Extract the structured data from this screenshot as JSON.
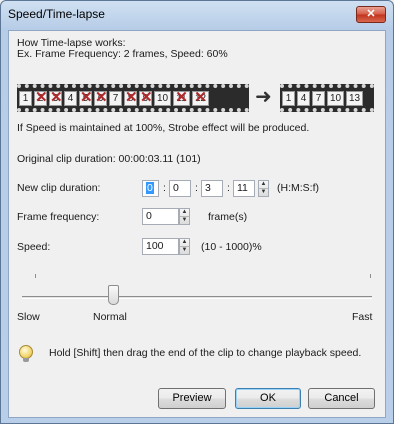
{
  "window": {
    "title": "Speed/Time-lapse",
    "close_glyph": "✕"
  },
  "info": {
    "line1": "How Time-lapse works:",
    "line2": "Ex. Frame Frequency: 2 frames, Speed: 60%"
  },
  "film_source": {
    "frames": [
      {
        "label": "1",
        "crossed": false
      },
      {
        "label": "2",
        "crossed": true
      },
      {
        "label": "3",
        "crossed": true
      },
      {
        "label": "4",
        "crossed": false
      },
      {
        "label": "5",
        "crossed": true
      },
      {
        "label": "6",
        "crossed": true
      },
      {
        "label": "7",
        "crossed": false
      },
      {
        "label": "8",
        "crossed": true
      },
      {
        "label": "9",
        "crossed": true
      },
      {
        "label": "10",
        "crossed": false
      },
      {
        "label": "11",
        "crossed": true
      },
      {
        "label": "12",
        "crossed": true
      }
    ]
  },
  "film_result": {
    "frames": [
      "1",
      "4",
      "7",
      "10",
      "13"
    ]
  },
  "arrow_glyph": "➜",
  "strobe_note": "If Speed is maintained at 100%, Strobe effect will be produced.",
  "original_duration": "Original clip duration: 00:00:03.11 (101)",
  "new_duration": {
    "label": "New clip duration:",
    "h": "0",
    "m": "0",
    "s": "3",
    "f": "11",
    "sep": ":",
    "format": "(H:M:S:f)"
  },
  "frame_frequency": {
    "label": "Frame frequency:",
    "value": "0",
    "unit": "frame(s)"
  },
  "speed": {
    "label": "Speed:",
    "value": "100",
    "range": "(10 - 1000)%"
  },
  "slider": {
    "slow": "Slow",
    "normal": "Normal",
    "fast": "Fast",
    "position_fraction": 0.25
  },
  "tip": "Hold [Shift] then drag the end of the clip to change playback speed.",
  "buttons": {
    "preview": "Preview",
    "ok": "OK",
    "cancel": "Cancel"
  },
  "icons": {
    "spin_up": "▲",
    "spin_down": "▼"
  }
}
